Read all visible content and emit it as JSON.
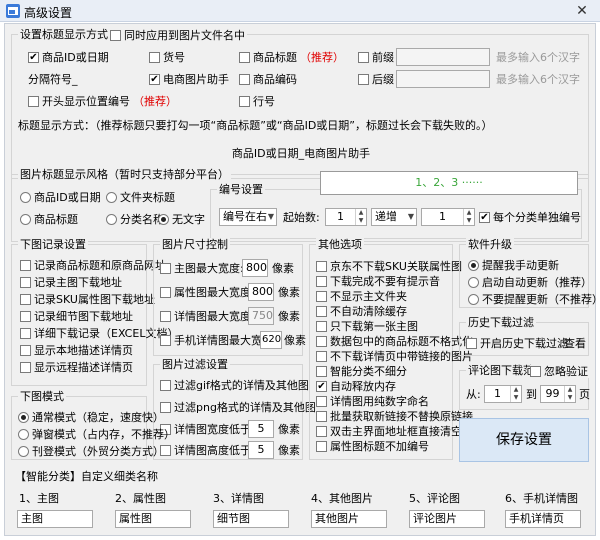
{
  "window": {
    "title": "高级设置",
    "close": "✕"
  },
  "title_group": {
    "title": "设置标题显示方式",
    "sync_filename": "同时应用到图片文件名中",
    "product_id": "商品ID或日期",
    "item_no": "货号",
    "product_title": "商品标题",
    "recommend": "（推荐）",
    "prefix": "前缀",
    "prefix_hint": "最多输入6个汉字",
    "separator_label": "分隔符号_",
    "assistant": "电商图片助手",
    "product_code": "商品编码",
    "suffix": "后缀",
    "suffix_hint": "最多输入6个汉字",
    "lead_number": "开头显示位置编号",
    "lead_recommend": "（推荐）",
    "row_number": "行号",
    "note": "标题显示方式：（推荐标题只要打勾一项“商品标题”或“商品ID或日期”，标题过长会下载失败的。）",
    "preview": "商品ID或日期_电商图片助手"
  },
  "style_group": {
    "title": "图片标题显示风格（暂时只支持部分平台）",
    "opts": [
      "商品ID或日期",
      "文件夹标题",
      "商品标题",
      "分类名称",
      "无文字"
    ],
    "number_title": "编号设置",
    "position": "编号在右",
    "start_label": "起始数:",
    "start": "1",
    "order": "递增",
    "step": "1",
    "per_category": "每个分类单独编号",
    "sequence": "1、2、3 ······"
  },
  "download_record": {
    "title": "下图记录设置",
    "items": [
      "记录商品标题和原商品网址",
      "记录主图下载地址",
      "记录SKU属性图下载地址",
      "记录细节图下载地址",
      "详细下载记录（EXCEL文档）",
      "显示本地描述详情页",
      "显示远程描述详情页"
    ]
  },
  "size_control": {
    "title": "图片尺寸控制",
    "rows": [
      {
        "label": "主图最大宽度:",
        "value": "800",
        "unit": "像素"
      },
      {
        "label": "属性图最大宽度:",
        "value": "800",
        "unit": "像素"
      },
      {
        "label": "详情图最大宽度:",
        "value": "750",
        "unit": "像素"
      },
      {
        "label": "手机详情图最大宽度:",
        "value": "620",
        "unit": "像素"
      }
    ]
  },
  "filter": {
    "title": "图片过滤设置",
    "gif": "过滤gif格式的详情及其他图",
    "png": "过滤png格式的详情及其他图",
    "width_label": "详情图宽度低于:",
    "width_value": "5",
    "height_label": "详情图高度低于:",
    "height_value": "5",
    "unit": "像素"
  },
  "other": {
    "title": "其他选项",
    "items": [
      "京东不下载SKU关联属性图",
      "下载完成不要有提示音",
      "不显示主文件夹",
      "不自动清除缓存",
      "只下载第一张主图",
      "数据包中的商品标题不格式化",
      "不下载详情页中带链接的图片",
      "智能分类不细分",
      "自动释放内存",
      "详情图用纯数字命名",
      "批量获取新链接不替换原链接",
      "双击主界面地址框直接清空",
      "属性图标题不加编号"
    ]
  },
  "download_mode": {
    "title": "下图模式",
    "opts": [
      "通常模式（稳定，速度快）",
      "弹窗模式（占内存，不推荐）",
      "刊登模式（外贸分类方式）"
    ]
  },
  "upgrade": {
    "title": "软件升级",
    "opts": [
      "提醒我手动更新",
      "启动自动更新（推荐）",
      "不要提醒更新（不推荐）"
    ]
  },
  "history": {
    "title": "历史下载过滤",
    "enable": "开启历史下载过滤",
    "view": "查看"
  },
  "review": {
    "title": "评论图下载范围",
    "ignore": "忽略验证",
    "from_label": "从:",
    "from": "1",
    "to_label": "到",
    "to": "99",
    "page": "页"
  },
  "save_label": "保存设置",
  "category": {
    "title": "【智能分类】自定义细类名称",
    "items": [
      {
        "label": "1、主图",
        "value": "主图"
      },
      {
        "label": "2、属性图",
        "value": "属性图"
      },
      {
        "label": "3、详情图",
        "value": "细节图"
      },
      {
        "label": "4、其他图片",
        "value": "其他图片"
      },
      {
        "label": "5、评论图",
        "value": "评论图片"
      },
      {
        "label": "6、手机详情图",
        "value": "手机详情页"
      }
    ]
  }
}
